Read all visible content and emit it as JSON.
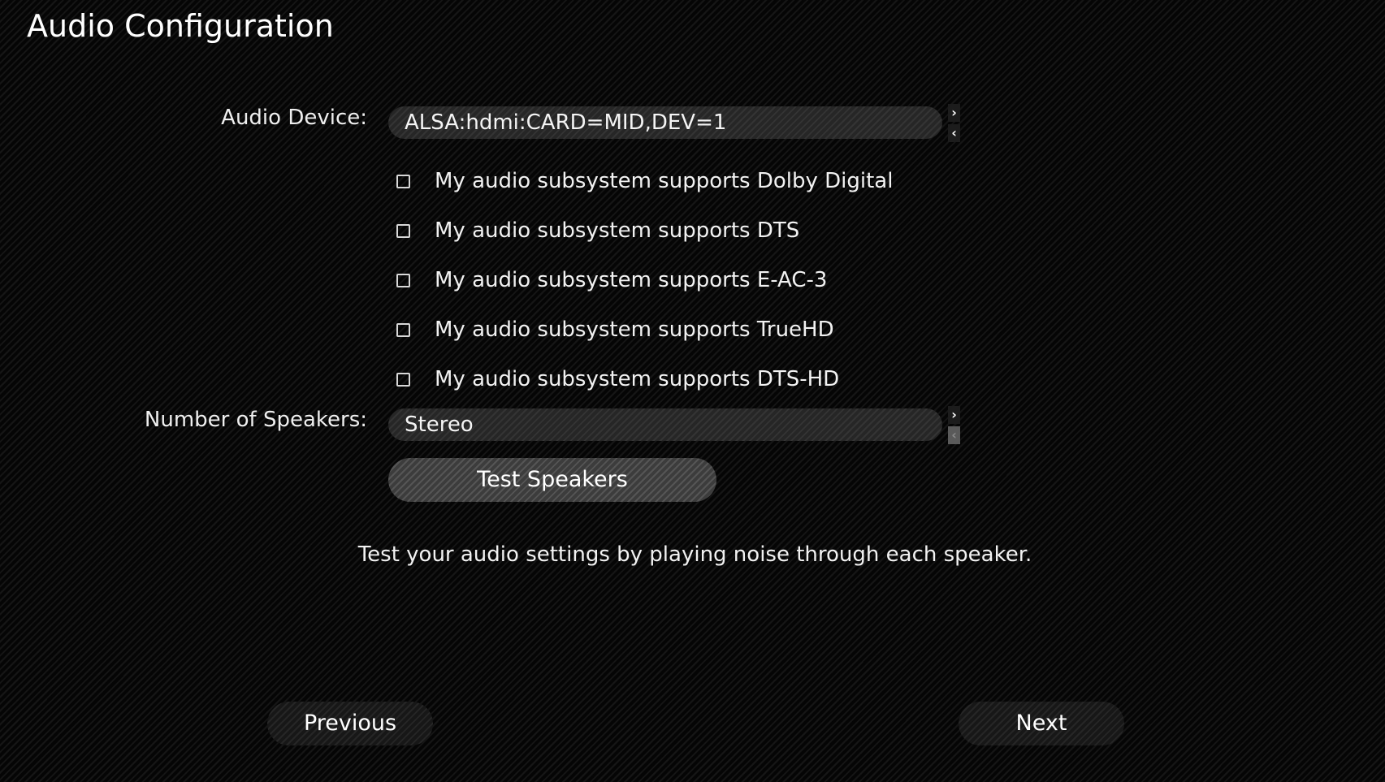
{
  "page": {
    "title": "Audio Configuration"
  },
  "audio_device": {
    "label": "Audio Device:",
    "value": "ALSA:hdmi:CARD=MID,DEV=1",
    "next_icon": "chevron-right-icon",
    "prev_icon": "chevron-left-icon"
  },
  "checkboxes": [
    {
      "label": "My audio subsystem supports Dolby Digital",
      "checked": false
    },
    {
      "label": "My audio subsystem supports DTS",
      "checked": false
    },
    {
      "label": "My audio subsystem supports E-AC-3",
      "checked": false
    },
    {
      "label": "My audio subsystem supports TrueHD",
      "checked": false
    },
    {
      "label": "My audio subsystem supports DTS-HD",
      "checked": false
    }
  ],
  "speakers": {
    "label": "Number of Speakers:",
    "value": "Stereo",
    "prev_disabled": true
  },
  "test_button": {
    "label": "Test Speakers"
  },
  "help_text": "Test your audio settings by playing noise through each speaker.",
  "nav": {
    "previous_label": "Previous",
    "next_label": "Next"
  },
  "colors": {
    "background": "#0b0b0b",
    "text": "#f2f2f2",
    "selector_bg": "#2a2a2a",
    "button_bg": "#444444"
  }
}
